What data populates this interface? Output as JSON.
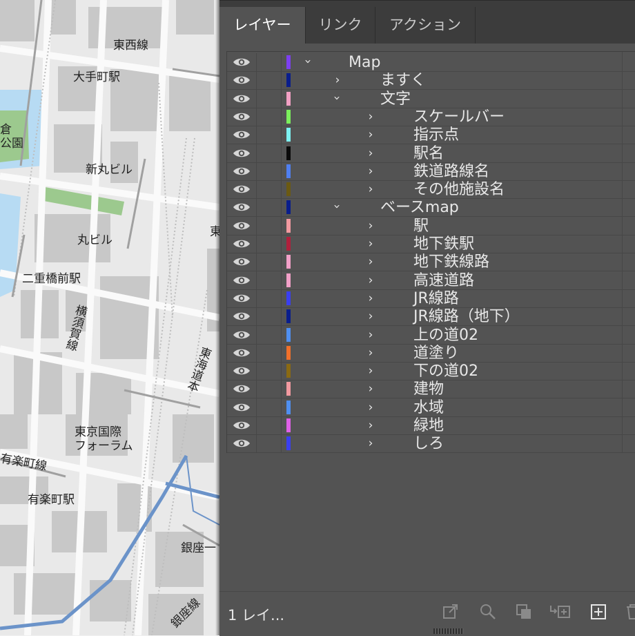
{
  "map": {
    "labels": {
      "tozai_line": "東西線",
      "otemachi_station": "大手町駅",
      "park_left_1": "倉",
      "park_left_2": "公園",
      "shin_maru_building": "新丸ビル",
      "maru_building": "丸ビル",
      "nijubashimae_station": "二重橋前駅",
      "yokosuka_line": "横須賀線",
      "tokaido_line": "東海道本",
      "east_partial": "東",
      "tokyo_forum_1": "東京国際",
      "tokyo_forum_2": "フォーラム",
      "yurakucho_line": "有楽町線",
      "yurakucho_station": "有楽町駅",
      "ginza_1": "銀座一",
      "ginza_line": "銀座線"
    },
    "colors": {
      "water": "#b7dbf3",
      "green": "#9cc98e",
      "rail_blue": "#6b93c9",
      "building": "#c6c6c6",
      "road": "#fafafa"
    }
  },
  "panel": {
    "tabs": [
      {
        "label": "レイヤー",
        "active": true
      },
      {
        "label": "リンク",
        "active": false
      },
      {
        "label": "アクション",
        "active": false
      }
    ],
    "layers": [
      {
        "name": "Map",
        "color": "#7d3ff0",
        "level": 0,
        "expanded": true
      },
      {
        "name": "ますく",
        "color": "#0a1e8c",
        "level": 1,
        "expanded": false
      },
      {
        "name": "文字",
        "color": "#f2a0c4",
        "level": 1,
        "expanded": true
      },
      {
        "name": "スケールバー",
        "color": "#7bef5c",
        "level": 2,
        "expanded": false
      },
      {
        "name": "指示点",
        "color": "#7df2f2",
        "level": 2,
        "expanded": false
      },
      {
        "name": "駅名",
        "color": "#0a0a0a",
        "level": 2,
        "expanded": false
      },
      {
        "name": "鉄道路線名",
        "color": "#4f7ff0",
        "level": 2,
        "expanded": false
      },
      {
        "name": "その他施設名",
        "color": "#6b5a12",
        "level": 2,
        "expanded": false
      },
      {
        "name": "ベースmap",
        "color": "#0a1e8c",
        "level": 1,
        "expanded": true
      },
      {
        "name": "駅",
        "color": "#f29aa0",
        "level": 2,
        "expanded": false
      },
      {
        "name": "地下鉄駅",
        "color": "#b0203c",
        "level": 2,
        "expanded": false
      },
      {
        "name": "地下鉄線路",
        "color": "#f2a0c8",
        "level": 2,
        "expanded": false
      },
      {
        "name": "高速道路",
        "color": "#f2a0c8",
        "level": 2,
        "expanded": false
      },
      {
        "name": "JR線路",
        "color": "#3a3ff0",
        "level": 2,
        "expanded": false
      },
      {
        "name": "JR線路（地下）",
        "color": "#0a1e8c",
        "level": 2,
        "expanded": false
      },
      {
        "name": "上の道02",
        "color": "#4f8ff0",
        "level": 2,
        "expanded": false
      },
      {
        "name": "道塗り",
        "color": "#f0702a",
        "level": 2,
        "expanded": false
      },
      {
        "name": "下の道02",
        "color": "#8a6a12",
        "level": 2,
        "expanded": false
      },
      {
        "name": "建物",
        "color": "#f29aa0",
        "level": 2,
        "expanded": false
      },
      {
        "name": "水域",
        "color": "#4f8ff0",
        "level": 2,
        "expanded": false
      },
      {
        "name": "緑地",
        "color": "#e060e8",
        "level": 2,
        "expanded": false
      },
      {
        "name": "しろ",
        "color": "#3a3ff0",
        "level": 2,
        "expanded": false
      }
    ],
    "footer": {
      "layer_count": "1 レイ...",
      "icons": [
        "export-icon",
        "search-icon",
        "clip-mask-icon",
        "sublayer-add-icon",
        "new-layer-icon",
        "trash-icon"
      ]
    }
  }
}
